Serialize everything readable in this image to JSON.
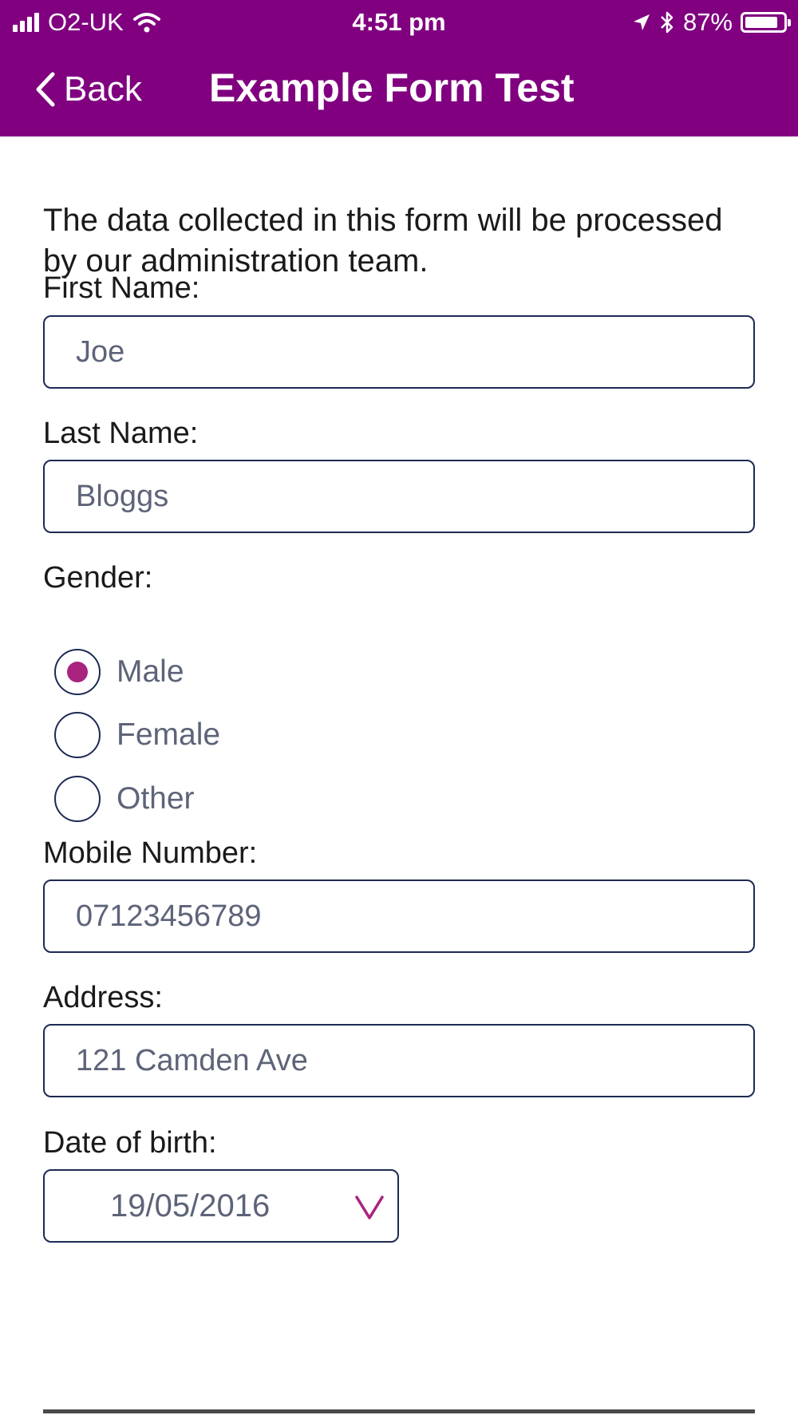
{
  "status_bar": {
    "carrier": "O2-UK",
    "time": "4:51 pm",
    "battery": "87%",
    "battery_level": 0.87,
    "icons": [
      "signal-icon",
      "wifi-icon",
      "location-icon",
      "bluetooth-icon",
      "battery-icon"
    ]
  },
  "nav": {
    "back_label": "Back",
    "title": "Example Form Test"
  },
  "form": {
    "intro": "The data collected in this form will be processed by our administration team.",
    "first_name": {
      "label": "First Name:",
      "value": "Joe"
    },
    "last_name": {
      "label": "Last Name:",
      "value": "Bloggs"
    },
    "gender": {
      "label": "Gender:",
      "options": [
        "Male",
        "Female",
        "Other"
      ],
      "selected": "Male"
    },
    "mobile": {
      "label": "Mobile Number:",
      "value": "07123456789"
    },
    "address": {
      "label": "Address:",
      "value": "121 Camden Ave"
    },
    "dob": {
      "label": "Date of birth:",
      "value": "19/05/2016"
    }
  },
  "colors": {
    "header_bg": "#800080",
    "accent": "#a8237d",
    "field_border": "#1d2a52",
    "field_text": "#5d6479"
  }
}
